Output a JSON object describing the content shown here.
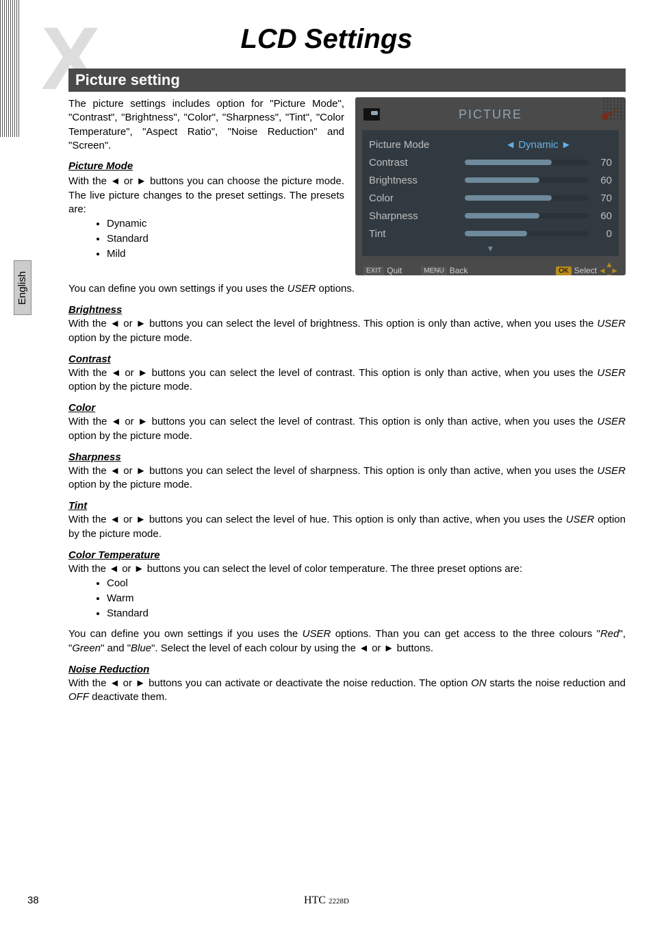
{
  "watermark": "X",
  "mainTitle": "LCD Settings",
  "headingBar": "Picture setting",
  "sideTab": "English",
  "intro": {
    "paragraph": "The picture settings includes option for \"Picture Mode\", \"Contrast\", \"Brightness\", \"Color\", \"Sharpness\", \"Tint\", \"Color Temperature\", \"Aspect Ratio\", \"Noise Reduction\" and \"Screen\".",
    "pmLabel": "Picture Mode",
    "pmText": "With the ◄ or ► buttons you can choose the picture mode. The live picture changes to the preset settings. The presets are:",
    "pmBullets": [
      "Dynamic",
      "Standard",
      "Mild"
    ]
  },
  "afterBullets": "You can define you own settings if you uses the USER options.",
  "sections": [
    {
      "label": "Brightness",
      "text": "With the ◄ or ► buttons you can select the level of brightness. This option is only than active, when you uses the USER option by the picture mode."
    },
    {
      "label": "Contrast",
      "text": "With the ◄ or ► buttons you can select the level of contrast. This option is only than active, when you uses the USER option by the picture mode."
    },
    {
      "label": "Color",
      "text": "With the ◄ or ► buttons you can select the level of contrast. This option is only than active, when you uses the USER option by the picture mode."
    },
    {
      "label": "Sharpness",
      "text": "With the ◄ or ► buttons you can select the level of sharpness. This option is only than active, when you uses the USER option by the picture mode."
    },
    {
      "label": "Tint",
      "text": "With the ◄ or ► buttons you can select the level of hue. This option is only than active, when you uses the USER option by the picture mode."
    }
  ],
  "colorTemp": {
    "label": "Color Temperature",
    "text": "With the ◄ or ► buttons you can select the level of color temperature. The three preset options are:",
    "bullets": [
      "Cool",
      "Warm",
      "Standard"
    ],
    "after": "You can define you own settings if you uses the USER options. Than you can get access to the three colours \"Red\", \"Green\" and \"Blue\". Select the level of each colour by using the ◄ or ► buttons."
  },
  "noise": {
    "label": "Noise Reduction",
    "text": "With the ◄ or ► buttons you can activate or deactivate the noise reduction. The option ON starts the noise reduction and OFF deactivate them."
  },
  "osd": {
    "title": "PICTURE",
    "rows": [
      {
        "label": "Picture Mode",
        "type": "text",
        "value": "◄ Dynamic ►"
      },
      {
        "label": "Contrast",
        "type": "slider",
        "value": 70,
        "max": 100
      },
      {
        "label": "Brightness",
        "type": "slider",
        "value": 60,
        "max": 100
      },
      {
        "label": "Color",
        "type": "slider",
        "value": 70,
        "max": 100
      },
      {
        "label": "Sharpness",
        "type": "slider",
        "value": 60,
        "max": 100
      },
      {
        "label": "Tint",
        "type": "slider",
        "value": 0,
        "max": 100
      }
    ],
    "footer": {
      "exit": "EXIT",
      "exitLabel": "Quit",
      "menu": "MENU",
      "menuLabel": "Back",
      "ok": "OK",
      "okLabel": "Select"
    }
  },
  "footer": {
    "page": "38",
    "model": "HTC ",
    "modelSuffix": "2228D"
  }
}
